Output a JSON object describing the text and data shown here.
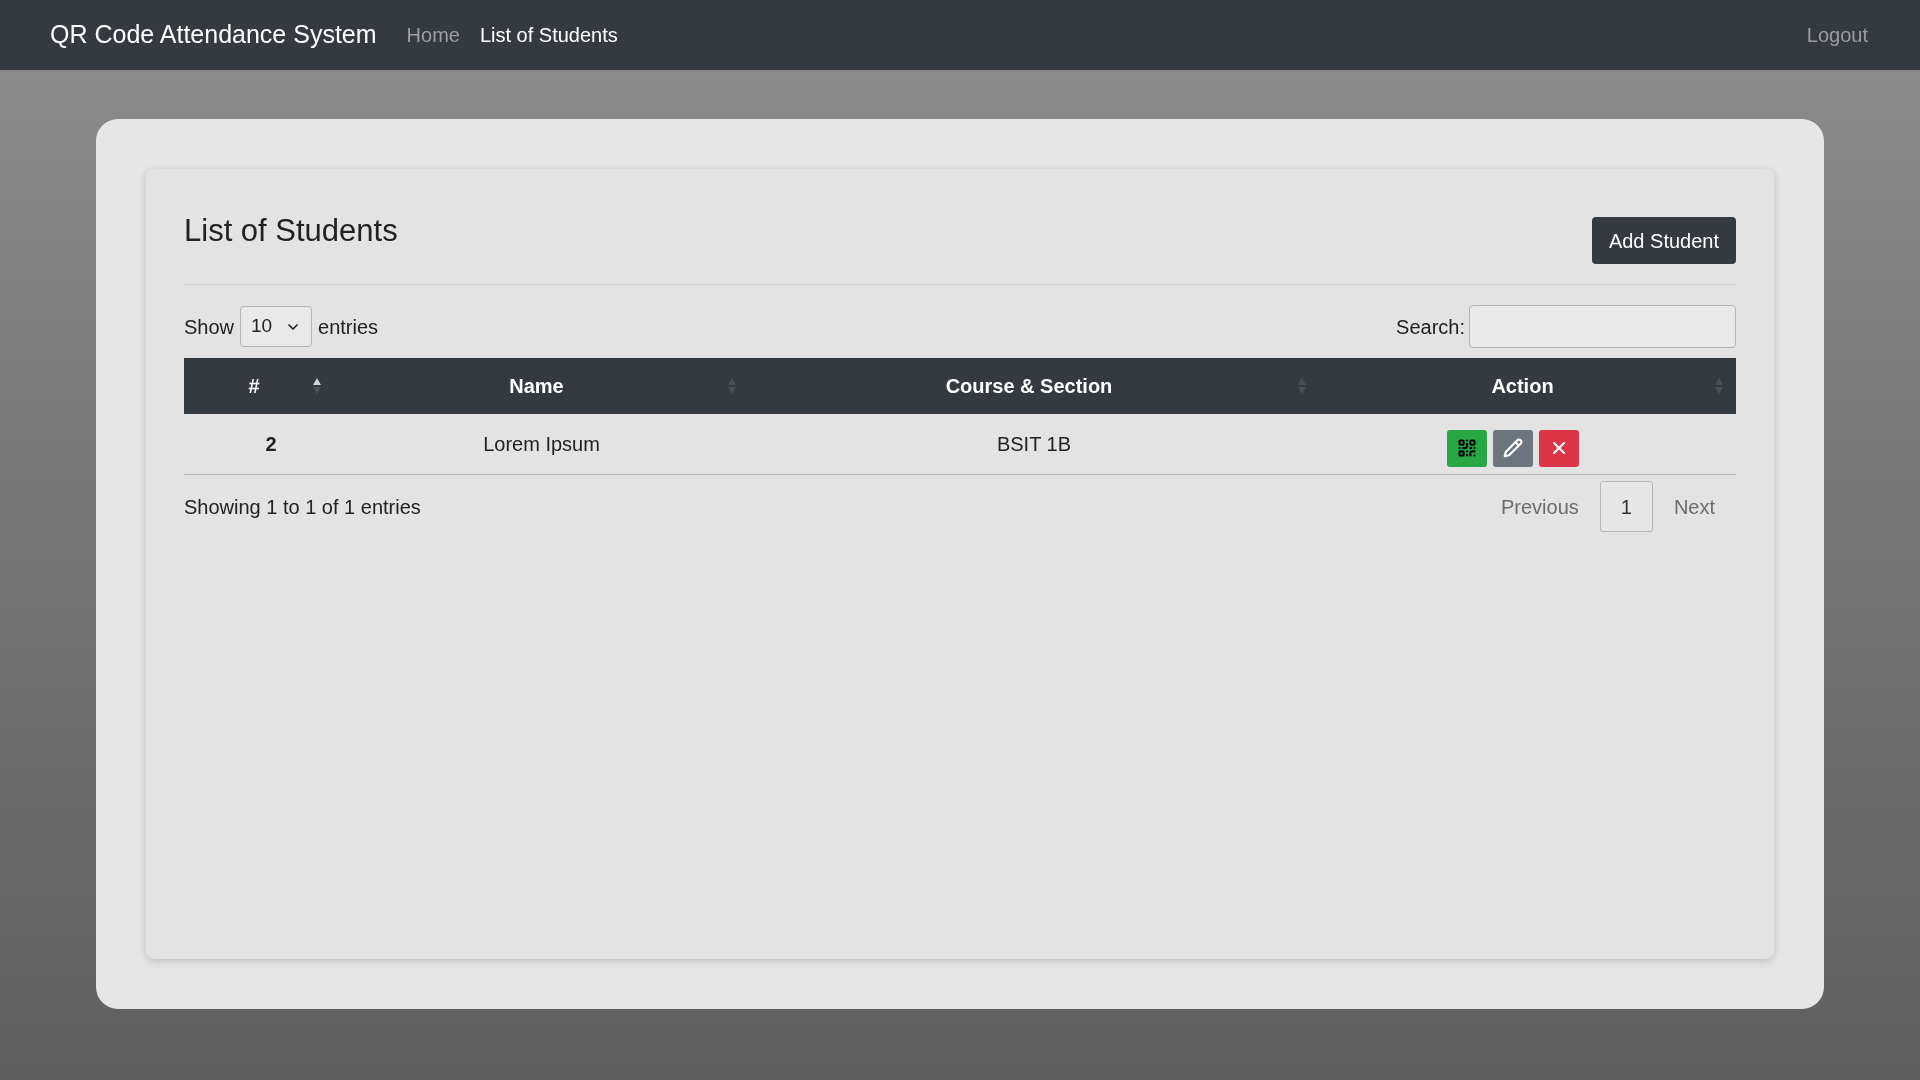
{
  "navbar": {
    "brand": "QR Code Attendance System",
    "items": [
      {
        "label": "Home",
        "selected": false
      },
      {
        "label": "List of Students",
        "selected": true
      }
    ],
    "logout": "Logout"
  },
  "card": {
    "title": "List of Students",
    "add_button": "Add Student"
  },
  "length": {
    "before": "Show",
    "value": "10",
    "after": "entries"
  },
  "search": {
    "label": "Search:"
  },
  "table": {
    "columns": [
      {
        "label": "#",
        "sorted": true
      },
      {
        "label": "Name",
        "sorted": false
      },
      {
        "label": "Course & Section",
        "sorted": false
      },
      {
        "label": "Action",
        "sorted": false
      }
    ],
    "rows": [
      {
        "number": "2",
        "name": "Lorem Ipsum",
        "course": "BSIT 1B",
        "actions": [
          {
            "kind": "qr"
          },
          {
            "kind": "edit"
          },
          {
            "kind": "delete"
          }
        ]
      }
    ]
  },
  "info": "Showing 1 to 1 of 1 entries",
  "pagination": [
    {
      "label": "Previous",
      "disabled": true,
      "selected": false
    },
    {
      "label": "1",
      "disabled": false,
      "selected": true
    },
    {
      "label": "Next",
      "disabled": true,
      "selected": false
    }
  ]
}
